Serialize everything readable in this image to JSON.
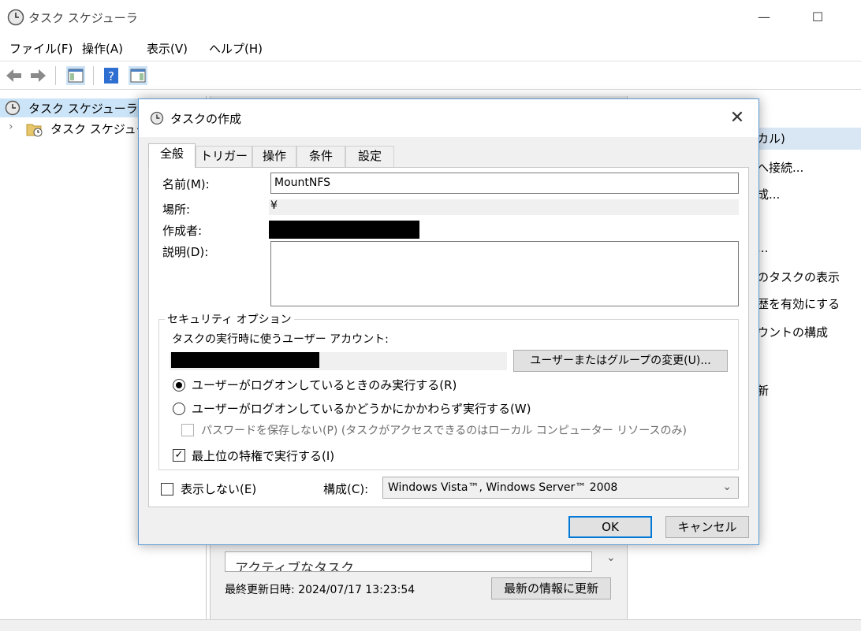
{
  "window": {
    "title": "タスク スケジューラ",
    "minimize": "—",
    "maximize": "☐"
  },
  "menu": [
    "ファイル(F)",
    "操作(A)",
    "表示(V)",
    "ヘルプ(H)"
  ],
  "tree": {
    "root": "タスク スケジューラ (ロ",
    "child": "タスク スケジューラ"
  },
  "right_pane": {
    "header": "カル)",
    "actions": [
      "へ接続...",
      "成...",
      "...",
      "のタスクの表示",
      "歴を有効にする",
      "ウントの構成",
      "新"
    ]
  },
  "center_pane": {
    "active_tasks": "アクティブなタスク",
    "last_updated": "最終更新日時: 2024/07/17 13:23:54",
    "refresh_button": "最新の情報に更新"
  },
  "dialog": {
    "title": "タスクの作成",
    "close": "✕",
    "tabs": [
      "全般",
      "トリガー",
      "操作",
      "条件",
      "設定"
    ],
    "name_label": "名前(M):",
    "name_value": "MountNFS",
    "location_label": "場所:",
    "location_value": "¥",
    "author_label": "作成者:",
    "description_label": "説明(D):",
    "description_value": "",
    "security": {
      "title": "セキュリティ オプション",
      "account_label": "タスクの実行時に使うユーザー アカウント:",
      "change_button": "ユーザーまたはグループの変更(U)...",
      "radio_logged_on": "ユーザーがログオンしているときのみ実行する(R)",
      "radio_whether": "ユーザーがログオンしているかどうかにかかわらず実行する(W)",
      "no_store_password": "パスワードを保存しない(P) (タスクがアクセスできるのはローカル コンピューター リソースのみ)",
      "highest_privileges": "最上位の特権で実行する(I)"
    },
    "hidden_label": "表示しない(E)",
    "configure_label": "構成(C):",
    "configure_value": "Windows Vista™, Windows Server™ 2008",
    "ok_button": "OK",
    "cancel_button": "キャンセル"
  },
  "colors": {
    "accent": "#0078d7",
    "selection": "#cce4f7",
    "dialog_border": "#5a9bd6"
  }
}
